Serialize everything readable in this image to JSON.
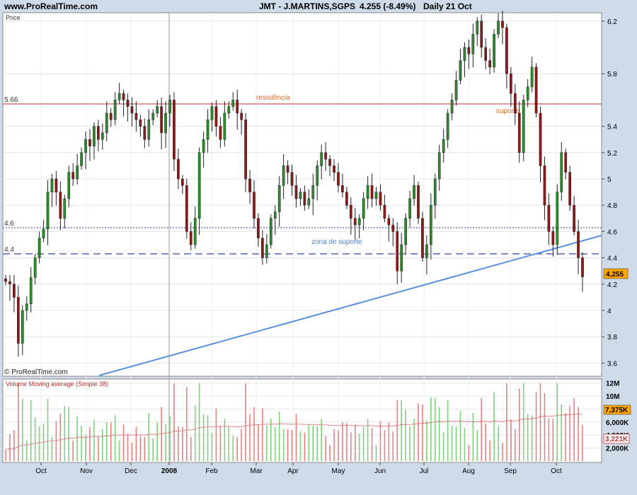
{
  "header": {
    "site": "www.ProRealTime.com",
    "ticker": "JMT - J.MARTINS,SGPS",
    "price": "4.255 (-8.49%)",
    "period": "Daily 21 Oct"
  },
  "copyright": "© ProRealTime.com",
  "colors": {
    "up_candle": "#2e8b2e",
    "down_candle": "#8b1a1a",
    "resistance": "#c03030",
    "support_line": "#3344aa",
    "trendline": "#5b8fe0",
    "volume_up": "#7fd07f",
    "volume_down": "#e88080",
    "panel_bg": "#ffffff",
    "frame_bg": "#cfdbe9",
    "price_marker_bg": "#ffa500"
  },
  "chart_data": [
    {
      "type": "candlestick",
      "ylabel": "Price",
      "ylim": [
        3.6,
        6.35
      ],
      "y_ticks": [
        "6.2",
        "5.8",
        "5.4",
        "5.2",
        "5",
        "4.8",
        "4.6",
        "4.4",
        "4.2",
        "4",
        "3.8",
        "3.6"
      ],
      "x_ticks": [
        "Oct",
        "Nov",
        "Dec",
        "2008",
        "Feb",
        "Mar",
        "Apr",
        "May",
        "Jun",
        "Jul",
        "Aug",
        "Sep",
        "Oct"
      ],
      "last_price_label": "4.255",
      "level_labels": {
        "resistance": "5.66",
        "support_high": "4.6",
        "support_low": "4.4"
      },
      "horizontal_levels": [
        {
          "value": 5.66,
          "style": "solid",
          "annotation": "resistência"
        },
        {
          "value": 4.6,
          "style": "dotted"
        },
        {
          "value": 4.4,
          "style": "dashed"
        }
      ],
      "annotations": [
        "resistência",
        "suporte",
        "zona de suporte"
      ],
      "trendline": {
        "from": {
          "x": "2008-01",
          "y": 3.55
        },
        "to": {
          "x": "2008-10-21",
          "y": 4.53
        }
      },
      "closes": [
        4.22,
        4.2,
        4.1,
        3.75,
        4.0,
        4.05,
        4.25,
        4.4,
        4.55,
        4.62,
        4.9,
        5.0,
        4.9,
        4.7,
        4.85,
        5.05,
        5.0,
        5.1,
        5.2,
        5.3,
        5.25,
        5.4,
        5.3,
        5.35,
        5.5,
        5.45,
        5.6,
        5.65,
        5.6,
        5.55,
        5.5,
        5.45,
        5.4,
        5.3,
        5.45,
        5.5,
        5.55,
        5.35,
        5.5,
        5.6,
        5.15,
        5.0,
        4.95,
        4.6,
        4.5,
        4.7,
        5.2,
        5.3,
        5.45,
        5.55,
        5.4,
        5.3,
        5.5,
        5.55,
        5.6,
        5.5,
        5.45,
        5.0,
        4.9,
        4.7,
        4.55,
        4.4,
        4.5,
        4.7,
        4.75,
        4.95,
        5.1,
        5.05,
        4.95,
        4.85,
        4.9,
        4.8,
        4.85,
        4.95,
        5.1,
        5.2,
        5.15,
        5.1,
        5.05,
        4.95,
        4.9,
        4.8,
        4.7,
        4.65,
        4.7,
        4.85,
        4.95,
        4.85,
        4.9,
        4.8,
        4.7,
        4.65,
        4.6,
        4.3,
        4.5,
        4.7,
        4.85,
        4.95,
        4.7,
        4.4,
        4.5,
        4.8,
        5.0,
        5.2,
        5.3,
        5.5,
        5.6,
        5.75,
        5.9,
        6.0,
        5.95,
        6.1,
        6.2,
        6.0,
        5.9,
        5.85,
        6.1,
        6.2,
        6.15,
        5.8,
        5.65,
        5.5,
        5.2,
        5.6,
        5.7,
        5.85,
        5.5,
        5.1,
        4.8,
        4.6,
        4.5,
        4.9,
        5.2,
        5.05,
        4.8,
        4.6,
        4.4,
        4.255
      ],
      "volume_panel": {
        "title": "Volume Moving average (Simple 38)",
        "y_ticks": [
          "12M",
          "10M",
          "8,000K",
          "6,000K",
          "4,000K",
          "2,000K"
        ],
        "last_volume_label": "7,375K",
        "moving_average_label": "3,221K"
      }
    }
  ]
}
